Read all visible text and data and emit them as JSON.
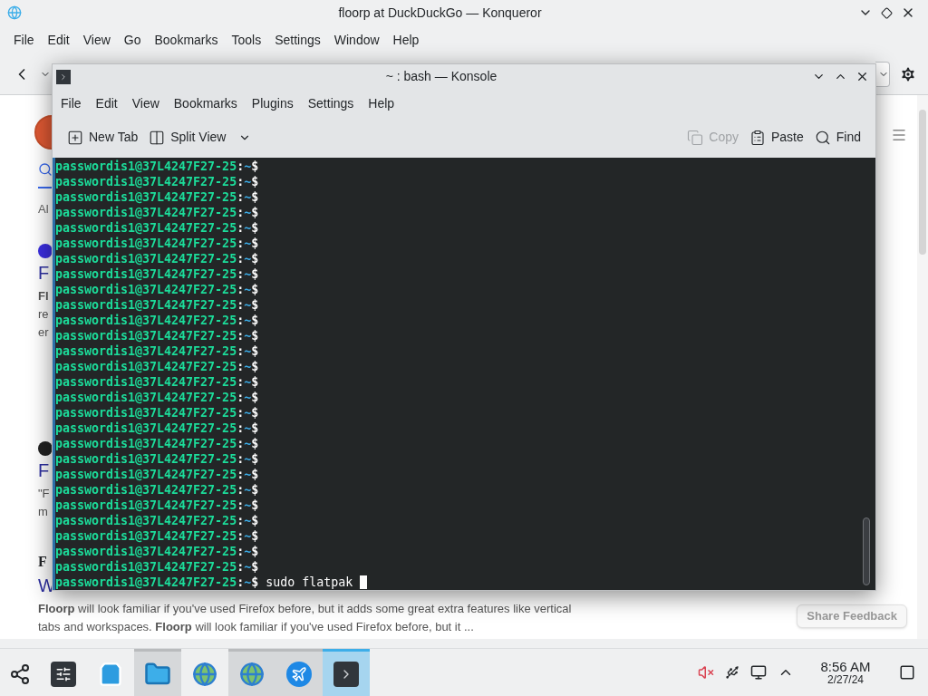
{
  "browser": {
    "title": "floorp at DuckDuckGo — Konqueror",
    "menu": [
      "File",
      "Edit",
      "View",
      "Go",
      "Bookmarks",
      "Tools",
      "Settings",
      "Window",
      "Help"
    ],
    "page": {
      "tab_label": "Al",
      "results": [
        {
          "kind": "icon",
          "title": "F",
          "snippet": [
            "**Fl**",
            "re",
            "er"
          ]
        },
        {
          "kind": "icon",
          "title": "F",
          "snippet": [
            "\"F",
            "m"
          ]
        },
        {
          "kind": "source",
          "source": "F",
          "title": "W",
          "snippet": [
            "**Floorp** will look familiar if you've used Firefox before, but it adds some great extra features like vertical",
            "tabs and workspaces. **Floorp** will look familiar if you've used Firefox before, but it ..."
          ]
        }
      ],
      "feedback_button": "Share Feedback"
    }
  },
  "konsole": {
    "title": "~ : bash — Konsole",
    "menu": [
      "File",
      "Edit",
      "View",
      "Bookmarks",
      "Plugins",
      "Settings",
      "Help"
    ],
    "toolbar": [
      {
        "kind": "new-tab",
        "label": "New Tab",
        "disabled": false
      },
      {
        "kind": "split",
        "label": "Split View",
        "disabled": false
      },
      {
        "kind": "copy",
        "label": "Copy",
        "disabled": true
      },
      {
        "kind": "paste",
        "label": "Paste",
        "disabled": false
      },
      {
        "kind": "find",
        "label": "Find",
        "disabled": false
      }
    ],
    "lines": [
      {
        "host": "passwordis1@37L4247F27-25",
        "sep": ":",
        "path": "~",
        "sign": "$"
      },
      {
        "host": "passwordis1@37L4247F27-25",
        "sep": ":",
        "path": "~",
        "sign": "$"
      },
      {
        "host": "passwordis1@37L4247F27-25",
        "sep": ":",
        "path": "~",
        "sign": "$"
      },
      {
        "host": "passwordis1@37L4247F27-25",
        "sep": ":",
        "path": "~",
        "sign": "$"
      },
      {
        "host": "passwordis1@37L4247F27-25",
        "sep": ":",
        "path": "~",
        "sign": "$"
      },
      {
        "host": "passwordis1@37L4247F27-25",
        "sep": ":",
        "path": "~",
        "sign": "$"
      },
      {
        "host": "passwordis1@37L4247F27-25",
        "sep": ":",
        "path": "~",
        "sign": "$"
      },
      {
        "host": "passwordis1@37L4247F27-25",
        "sep": ":",
        "path": "~",
        "sign": "$"
      },
      {
        "host": "passwordis1@37L4247F27-25",
        "sep": ":",
        "path": "~",
        "sign": "$"
      },
      {
        "host": "passwordis1@37L4247F27-25",
        "sep": ":",
        "path": "~",
        "sign": "$"
      },
      {
        "host": "passwordis1@37L4247F27-25",
        "sep": ":",
        "path": "~",
        "sign": "$"
      },
      {
        "host": "passwordis1@37L4247F27-25",
        "sep": ":",
        "path": "~",
        "sign": "$"
      },
      {
        "host": "passwordis1@37L4247F27-25",
        "sep": ":",
        "path": "~",
        "sign": "$"
      },
      {
        "host": "passwordis1@37L4247F27-25",
        "sep": ":",
        "path": "~",
        "sign": "$"
      },
      {
        "host": "passwordis1@37L4247F27-25",
        "sep": ":",
        "path": "~",
        "sign": "$"
      },
      {
        "host": "passwordis1@37L4247F27-25",
        "sep": ":",
        "path": "~",
        "sign": "$"
      },
      {
        "host": "passwordis1@37L4247F27-25",
        "sep": ":",
        "path": "~",
        "sign": "$"
      },
      {
        "host": "passwordis1@37L4247F27-25",
        "sep": ":",
        "path": "~",
        "sign": "$"
      },
      {
        "host": "passwordis1@37L4247F27-25",
        "sep": ":",
        "path": "~",
        "sign": "$"
      },
      {
        "host": "passwordis1@37L4247F27-25",
        "sep": ":",
        "path": "~",
        "sign": "$"
      },
      {
        "host": "passwordis1@37L4247F27-25",
        "sep": ":",
        "path": "~",
        "sign": "$"
      },
      {
        "host": "passwordis1@37L4247F27-25",
        "sep": ":",
        "path": "~",
        "sign": "$"
      },
      {
        "host": "passwordis1@37L4247F27-25",
        "sep": ":",
        "path": "~",
        "sign": "$"
      },
      {
        "host": "passwordis1@37L4247F27-25",
        "sep": ":",
        "path": "~",
        "sign": "$"
      },
      {
        "host": "passwordis1@37L4247F27-25",
        "sep": ":",
        "path": "~",
        "sign": "$"
      },
      {
        "host": "passwordis1@37L4247F27-25",
        "sep": ":",
        "path": "~",
        "sign": "$"
      },
      {
        "host": "passwordis1@37L4247F27-25",
        "sep": ":",
        "path": "~",
        "sign": "$"
      },
      {
        "host": "passwordis1@37L4247F27-25",
        "sep": ":",
        "path": "~",
        "sign": "$",
        "command": "sudo flatpak",
        "cursor": true
      }
    ]
  },
  "taskbar": {
    "apps": [
      {
        "kind": "launcher",
        "running": false,
        "selected": false
      },
      {
        "kind": "settings",
        "running": false,
        "selected": false
      },
      {
        "kind": "store",
        "running": false,
        "selected": false
      },
      {
        "kind": "files",
        "running": true,
        "selected": false
      },
      {
        "kind": "globe",
        "running": false,
        "selected": false
      },
      {
        "kind": "globe",
        "running": true,
        "selected": false
      },
      {
        "kind": "plane",
        "running": true,
        "selected": false
      },
      {
        "kind": "terminal",
        "running": true,
        "selected": true
      }
    ],
    "tray": {
      "muted": true
    },
    "time": "8:56 AM",
    "date": "2/27/24"
  }
}
